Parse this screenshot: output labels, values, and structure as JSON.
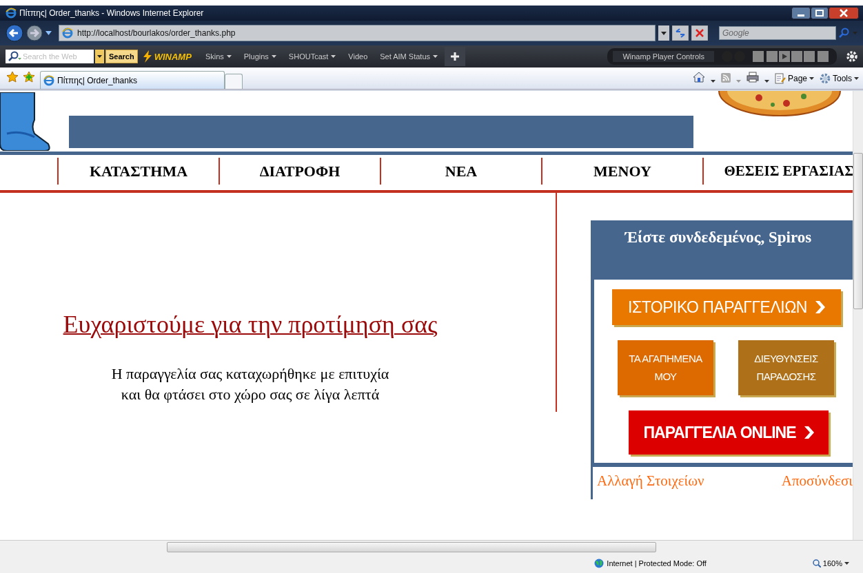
{
  "browser": {
    "title": "Πίτπης| Order_thanks - Windows Internet Explorer",
    "address": "http://localhost/bourlakos/order_thanks.php",
    "search_placeholder": "Google"
  },
  "toolbar": {
    "search_placeholder": "Search the Web",
    "search_button": "Search",
    "brand": "WINAMP",
    "menus": [
      {
        "label": "Skins",
        "dropdown": true
      },
      {
        "label": "Plugins",
        "dropdown": true
      },
      {
        "label": "SHOUTcast",
        "dropdown": true
      },
      {
        "label": "Video",
        "dropdown": false
      },
      {
        "label": "Set AIM Status",
        "dropdown": true
      }
    ],
    "player_label": "Winamp Player Controls"
  },
  "tabs": [
    {
      "label": "Πίτπης| Order_thanks",
      "selected": true
    }
  ],
  "command_bar": [
    {
      "label": "Page"
    },
    {
      "label": "Tools"
    }
  ],
  "page": {
    "nav": [
      "ΚΑΤΑΣΤΗΜΑ",
      "ΔΙΑΤΡΟΦΗ",
      "ΝΕΑ",
      "ΜΕΝΟΥ",
      "ΘΕΣΕΙΣ ΕΡΓΑΣΙΑΣ"
    ],
    "heading": "Ευχαριστούμε για την προτίμηση σας",
    "message": [
      "Η παραγγελία σας καταχωρήθηκε με επιτυχία",
      "και θα φτάσει στο χώρο σας σε λίγα λεπτά"
    ],
    "panel": {
      "greeting": "Έίστε συνδεδεμένος, Spiros",
      "buttons": [
        {
          "label": "ΙΣΤΟΡΙΚΟ ΠΑΡΑΓΓΕΛΙΩΝ",
          "kind": "wide",
          "color": "#e87800"
        },
        {
          "label": "ΤΑ ΑΓΑΠΗΜΕΝΑ ΜΟΥ",
          "kind": "small",
          "color": "#dd6a00"
        },
        {
          "label": "ΔΙΕΥΘΥΝΣΕΙΣ ΠΑΡΑΔΟΣΗΣ",
          "kind": "small",
          "color": "#ae7018"
        },
        {
          "label": "ΠΑΡΑΓΓΕΛΙΑ ONLINE",
          "kind": "wide",
          "color": "#dd0000"
        }
      ],
      "links": [
        "Αλλαγή Στοιχείων",
        "Αποσύνδεσι"
      ]
    }
  },
  "status_bar": {
    "zone": "Internet | Protected Mode: Off",
    "zoom": "160%"
  }
}
